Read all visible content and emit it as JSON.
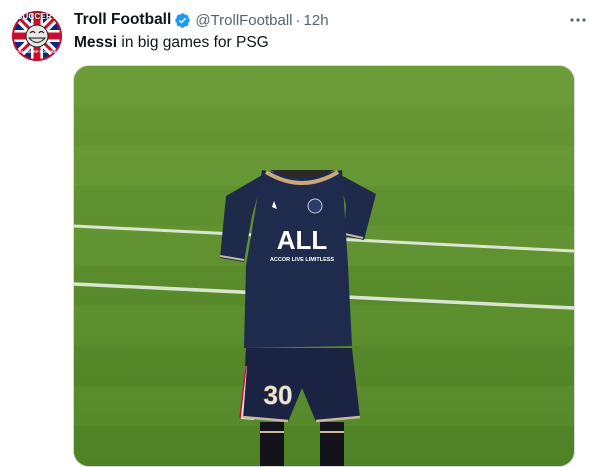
{
  "tweet": {
    "avatar": {
      "icon": "troll-football-logo-icon",
      "text_top": "SUCCERT",
      "text_bottom": "ROYAL DERP FOOTBALL"
    },
    "author": {
      "display_name": "Troll Football",
      "handle": "@TrollFootball",
      "separator": "·",
      "time": "12h",
      "verified_icon": "verified-badge-icon"
    },
    "text": {
      "bold": "Messi",
      "rest": " in big games for PSG"
    },
    "media": {
      "jersey_text": "ALL",
      "jersey_subtext": "ACCOR LIVE LIMITLESS",
      "number": "30"
    },
    "more_icon": "more-options-icon",
    "colors": {
      "verified": "#1d9bf0",
      "secondary_text": "#536471",
      "pitch": "#5a8b2d",
      "jersey": "#1e2a4a"
    }
  }
}
